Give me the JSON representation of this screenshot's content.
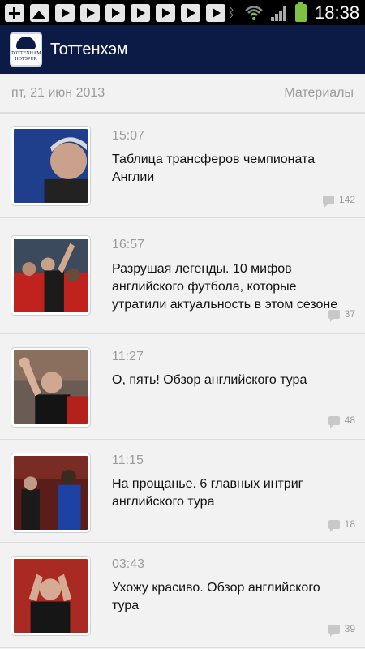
{
  "status_bar": {
    "time": "18:38",
    "icons": [
      "add-icon",
      "image-icon",
      "play-icon",
      "play-icon",
      "play-icon",
      "play-icon",
      "play-icon",
      "play-icon",
      "play-icon",
      "bluetooth-icon",
      "wifi-icon",
      "signal-icon",
      "battery-icon"
    ]
  },
  "app": {
    "title": "Тоттенхэм",
    "logo_text_1": "TOTTENHAM",
    "logo_text_2": "HOTSPUR"
  },
  "datebar": {
    "date": "пт, 21 июн 2013",
    "section": "Материалы"
  },
  "articles": [
    {
      "time": "15:07",
      "title": "Таблица трансферов чемпионата Англии",
      "comments": "142"
    },
    {
      "time": "16:57",
      "title": "Разрушая легенды. 10 мифов английского футбола, которые утратили актуальность в этом сезоне",
      "comments": "37"
    },
    {
      "time": "11:27",
      "title": "О, пять! Обзор английского тура",
      "comments": "48"
    },
    {
      "time": "11:15",
      "title": "На прощанье. 6 главных интриг английского тура",
      "comments": "18"
    },
    {
      "time": "03:43",
      "title": "Ухожу красиво. Обзор английского тура",
      "comments": "39"
    }
  ],
  "colors": {
    "header_bg": "#0c1a46",
    "background": "#f2f2f2",
    "muted_text": "#9b9b9b",
    "battery": "#7dc242"
  }
}
